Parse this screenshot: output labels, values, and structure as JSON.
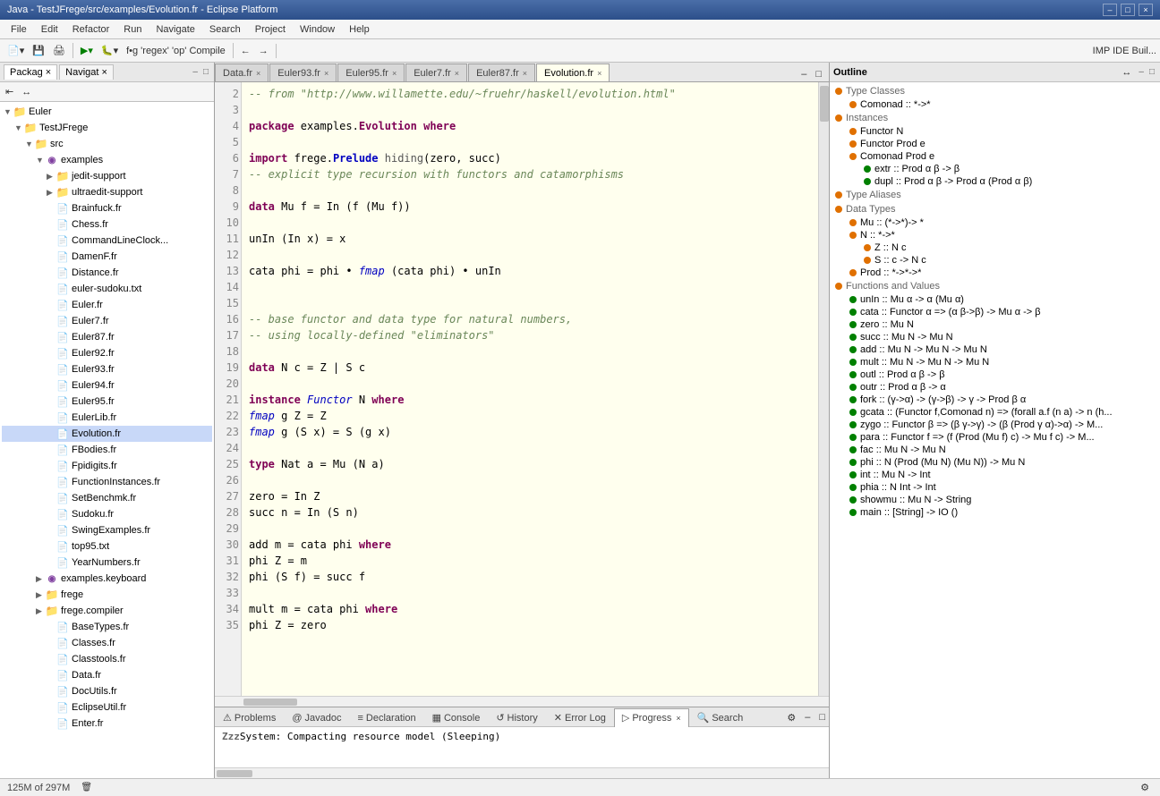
{
  "titlebar": {
    "title": "Java - TestJFrege/src/examples/Evolution.fr - Eclipse Platform",
    "controls": [
      "–",
      "□",
      "×"
    ]
  },
  "menubar": {
    "items": [
      "File",
      "Edit",
      "Refactor",
      "Run",
      "Navigate",
      "Search",
      "Project",
      "Window",
      "Help"
    ]
  },
  "left_panel": {
    "tabs": [
      {
        "label": "Packag",
        "active": true
      },
      {
        "label": "Navigat",
        "active": false
      }
    ],
    "tree": [
      {
        "indent": 0,
        "arrow": "▼",
        "icon": "folder",
        "label": "Euler",
        "level": 0
      },
      {
        "indent": 1,
        "arrow": "▼",
        "icon": "folder",
        "label": "TestJFrege",
        "level": 1
      },
      {
        "indent": 2,
        "arrow": "▼",
        "icon": "folder",
        "label": "src",
        "level": 2
      },
      {
        "indent": 3,
        "arrow": "▼",
        "icon": "package",
        "label": "examples",
        "level": 3
      },
      {
        "indent": 4,
        "arrow": "▶",
        "icon": "folder",
        "label": "jedit-support",
        "level": 4
      },
      {
        "indent": 4,
        "arrow": "▶",
        "icon": "folder",
        "label": "ultraedit-support",
        "level": 4
      },
      {
        "indent": 4,
        "arrow": "",
        "icon": "file",
        "label": "Brainfuck.fr",
        "level": 4
      },
      {
        "indent": 4,
        "arrow": "",
        "icon": "file",
        "label": "Chess.fr",
        "level": 4
      },
      {
        "indent": 4,
        "arrow": "",
        "icon": "file",
        "label": "CommandLineClock...",
        "level": 4
      },
      {
        "indent": 4,
        "arrow": "",
        "icon": "file",
        "label": "DamenF.fr",
        "level": 4
      },
      {
        "indent": 4,
        "arrow": "",
        "icon": "file",
        "label": "Distance.fr",
        "level": 4
      },
      {
        "indent": 4,
        "arrow": "",
        "icon": "file",
        "label": "euler-sudoku.txt",
        "level": 4
      },
      {
        "indent": 4,
        "arrow": "",
        "icon": "file",
        "label": "Euler.fr",
        "level": 4
      },
      {
        "indent": 4,
        "arrow": "",
        "icon": "file",
        "label": "Euler7.fr",
        "level": 4
      },
      {
        "indent": 4,
        "arrow": "",
        "icon": "file",
        "label": "Euler87.fr",
        "level": 4
      },
      {
        "indent": 4,
        "arrow": "",
        "icon": "file",
        "label": "Euler92.fr",
        "level": 4
      },
      {
        "indent": 4,
        "arrow": "",
        "icon": "file",
        "label": "Euler93.fr",
        "level": 4
      },
      {
        "indent": 4,
        "arrow": "",
        "icon": "file",
        "label": "Euler94.fr",
        "level": 4
      },
      {
        "indent": 4,
        "arrow": "",
        "icon": "file",
        "label": "Euler95.fr",
        "level": 4
      },
      {
        "indent": 4,
        "arrow": "",
        "icon": "file",
        "label": "EulerLib.fr",
        "level": 4
      },
      {
        "indent": 4,
        "arrow": "",
        "icon": "file",
        "label": "Evolution.fr",
        "level": 4,
        "selected": true
      },
      {
        "indent": 4,
        "arrow": "",
        "icon": "file",
        "label": "FBodies.fr",
        "level": 4
      },
      {
        "indent": 4,
        "arrow": "",
        "icon": "file",
        "label": "Fpidigits.fr",
        "level": 4
      },
      {
        "indent": 4,
        "arrow": "",
        "icon": "file",
        "label": "FunctionInstances.fr",
        "level": 4
      },
      {
        "indent": 4,
        "arrow": "",
        "icon": "file",
        "label": "SetBenchmk.fr",
        "level": 4
      },
      {
        "indent": 4,
        "arrow": "",
        "icon": "file",
        "label": "Sudoku.fr",
        "level": 4
      },
      {
        "indent": 4,
        "arrow": "",
        "icon": "file",
        "label": "SwingExamples.fr",
        "level": 4
      },
      {
        "indent": 4,
        "arrow": "",
        "icon": "file",
        "label": "top95.txt",
        "level": 4
      },
      {
        "indent": 4,
        "arrow": "",
        "icon": "file",
        "label": "YearNumbers.fr",
        "level": 4
      },
      {
        "indent": 3,
        "arrow": "▶",
        "icon": "package",
        "label": "examples.keyboard",
        "level": 3
      },
      {
        "indent": 3,
        "arrow": "▶",
        "icon": "folder",
        "label": "frege",
        "level": 3
      },
      {
        "indent": 3,
        "arrow": "▶",
        "icon": "folder",
        "label": "frege.compiler",
        "level": 3
      },
      {
        "indent": 4,
        "arrow": "",
        "icon": "file",
        "label": "BaseTypes.fr",
        "level": 4
      },
      {
        "indent": 4,
        "arrow": "",
        "icon": "file",
        "label": "Classes.fr",
        "level": 4
      },
      {
        "indent": 4,
        "arrow": "",
        "icon": "file",
        "label": "Classtools.fr",
        "level": 4
      },
      {
        "indent": 4,
        "arrow": "",
        "icon": "file",
        "label": "Data.fr",
        "level": 4
      },
      {
        "indent": 4,
        "arrow": "",
        "icon": "file",
        "label": "DocUtils.fr",
        "level": 4
      },
      {
        "indent": 4,
        "arrow": "",
        "icon": "file",
        "label": "EclipseUtil.fr",
        "level": 4
      },
      {
        "indent": 4,
        "arrow": "",
        "icon": "file",
        "label": "Enter.fr",
        "level": 4
      }
    ]
  },
  "editor": {
    "tabs": [
      {
        "label": "Data.fr",
        "active": false,
        "closeable": true
      },
      {
        "label": "Euler93.fr",
        "active": false,
        "closeable": true
      },
      {
        "label": "Euler95.fr",
        "active": false,
        "closeable": true
      },
      {
        "label": "Euler7.fr",
        "active": false,
        "closeable": true
      },
      {
        "label": "Euler87.fr",
        "active": false,
        "closeable": true
      },
      {
        "label": "Evolution.fr",
        "active": true,
        "closeable": true
      }
    ],
    "lines": [
      {
        "num": 2,
        "code": "<span class='comment'>-- from \"http://www.willamette.edu/~fruehr/haskell/evolution.html\"</span>"
      },
      {
        "num": 3,
        "code": ""
      },
      {
        "num": 4,
        "code": "<span class='kw'>package</span> examples.<span style='color:#7f0055;font-weight:bold'>Evolution</span> <span class='kw'>where</span>"
      },
      {
        "num": 5,
        "code": ""
      },
      {
        "num": 6,
        "code": "<span class='kw'>import</span> frege.<span style='color:#0000c0;font-weight:bold'>Prelude</span>  <span style='color:#555'>hiding</span>(zero, succ)"
      },
      {
        "num": 7,
        "code": "<span class='comment'>-- explicit type recursion with functors and catamorphisms</span>"
      },
      {
        "num": 8,
        "code": ""
      },
      {
        "num": 9,
        "code": "<span class='kw'>data</span> Mu f = In (f (Mu f))"
      },
      {
        "num": 10,
        "code": ""
      },
      {
        "num": 11,
        "code": "unIn (In x) = x"
      },
      {
        "num": 12,
        "code": ""
      },
      {
        "num": 13,
        "code": "cata phi = phi • <span class='fn-name'>fmap</span> (cata phi) • unIn"
      },
      {
        "num": 14,
        "code": ""
      },
      {
        "num": 15,
        "code": ""
      },
      {
        "num": 16,
        "code": "<span class='comment'>-- base functor and data type for natural numbers,</span>"
      },
      {
        "num": 17,
        "code": "<span class='comment'>-- using locally-defined \"eliminators\"</span>"
      },
      {
        "num": 18,
        "code": ""
      },
      {
        "num": 19,
        "code": "<span class='kw'>data</span> N c = Z | S c"
      },
      {
        "num": 20,
        "code": ""
      },
      {
        "num": 21,
        "code": "<span class='kw'>instance</span> <span class='fn-name'>Functor</span> N <span class='kw'>where</span>"
      },
      {
        "num": 22,
        "code": "    <span class='fn-name'>fmap</span> g  Z      = Z"
      },
      {
        "num": 23,
        "code": "    <span class='fn-name'>fmap</span> g (S x) = S (g x)"
      },
      {
        "num": 24,
        "code": ""
      },
      {
        "num": 25,
        "code": "<span class='kw'>type</span> Nat a = Mu (N a)"
      },
      {
        "num": 26,
        "code": ""
      },
      {
        "num": 27,
        "code": "zero    = In Z"
      },
      {
        "num": 28,
        "code": "succ n  = In (S n)"
      },
      {
        "num": 29,
        "code": ""
      },
      {
        "num": 30,
        "code": "add m = cata phi <span class='kw'>where</span>"
      },
      {
        "num": 31,
        "code": "    phi  Z      = m"
      },
      {
        "num": 32,
        "code": "    phi (S f) = succ f"
      },
      {
        "num": 33,
        "code": ""
      },
      {
        "num": 34,
        "code": "mult m = cata phi <span class='kw'>where</span>"
      },
      {
        "num": 35,
        "code": "    phi  Z      = zero"
      }
    ]
  },
  "outline": {
    "title": "Outline",
    "sections": [
      {
        "label": "Type Classes",
        "color": "orange",
        "items": [
          {
            "indent": 1,
            "label": "Comonad :: *->*",
            "color": "orange"
          }
        ]
      },
      {
        "label": "Instances",
        "color": "orange",
        "items": [
          {
            "indent": 1,
            "label": "Functor N",
            "color": "orange"
          },
          {
            "indent": 1,
            "label": "Functor Prod e",
            "color": "orange"
          },
          {
            "indent": 1,
            "label": "Comonad Prod e",
            "color": "orange"
          },
          {
            "indent": 2,
            "label": "extr :: Prod α β -> β",
            "color": "green"
          },
          {
            "indent": 2,
            "label": "dupl :: Prod α β -> Prod α (Prod α β)",
            "color": "green"
          }
        ]
      },
      {
        "label": "Type Aliases",
        "color": "orange",
        "items": []
      },
      {
        "label": "Data Types",
        "color": "orange",
        "items": [
          {
            "indent": 1,
            "label": "Mu :: (*->*)-> *",
            "color": "orange"
          },
          {
            "indent": 1,
            "label": "N :: *->*",
            "color": "orange"
          },
          {
            "indent": 2,
            "label": "Z :: N c",
            "color": "orange"
          },
          {
            "indent": 2,
            "label": "S :: c -> N c",
            "color": "orange"
          },
          {
            "indent": 1,
            "label": "Prod :: *->*->*",
            "color": "orange"
          }
        ]
      },
      {
        "label": "Functions and Values",
        "color": "orange",
        "items": [
          {
            "indent": 1,
            "label": "unIn :: Mu α -> α (Mu α)",
            "color": "green"
          },
          {
            "indent": 1,
            "label": "cata :: Functor α => (α β->β) -> Mu α -> β",
            "color": "green"
          },
          {
            "indent": 1,
            "label": "zero :: Mu N",
            "color": "green"
          },
          {
            "indent": 1,
            "label": "succ :: Mu N -> Mu N",
            "color": "green"
          },
          {
            "indent": 1,
            "label": "add :: Mu N -> Mu N -> Mu N",
            "color": "green"
          },
          {
            "indent": 1,
            "label": "mult :: Mu N -> Mu N -> Mu N",
            "color": "green"
          },
          {
            "indent": 1,
            "label": "outl :: Prod α β -> β",
            "color": "green"
          },
          {
            "indent": 1,
            "label": "outr :: Prod α β -> α",
            "color": "green"
          },
          {
            "indent": 1,
            "label": "fork :: (γ->α) -> (γ->β) -> γ -> Prod β α",
            "color": "green"
          },
          {
            "indent": 1,
            "label": "gcata :: (Functor f,Comonad n) => (forall a.f (n a) -> n (h...",
            "color": "green"
          },
          {
            "indent": 1,
            "label": "zygo :: Functor β => (β γ->γ) -> (β (Prod γ α)->α) -> M...",
            "color": "green"
          },
          {
            "indent": 1,
            "label": "para :: Functor f => (f (Prod (Mu f) c) -> Mu f c) -> M...",
            "color": "green"
          },
          {
            "indent": 1,
            "label": "fac :: Mu N -> Mu N",
            "color": "green"
          },
          {
            "indent": 1,
            "label": "phi :: N (Prod (Mu N) (Mu N)) -> Mu N",
            "color": "green"
          },
          {
            "indent": 1,
            "label": "int :: Mu N -> Int",
            "color": "green"
          },
          {
            "indent": 1,
            "label": "phia :: N Int -> Int",
            "color": "green"
          },
          {
            "indent": 1,
            "label": "showmu :: Mu N -> String",
            "color": "green"
          },
          {
            "indent": 1,
            "label": "main :: [String] -> IO ()",
            "color": "green"
          }
        ]
      }
    ]
  },
  "bottom_panel": {
    "tabs": [
      {
        "label": "Problems",
        "icon": "⚠",
        "active": false
      },
      {
        "label": "Javadoc",
        "icon": "@",
        "active": false
      },
      {
        "label": "Declaration",
        "icon": "≡",
        "active": false
      },
      {
        "label": "Console",
        "icon": "▦",
        "active": false
      },
      {
        "label": "History",
        "icon": "↺",
        "active": false
      },
      {
        "label": "Error Log",
        "icon": "✕",
        "active": false
      },
      {
        "label": "Progress",
        "icon": "▷",
        "active": true
      },
      {
        "label": "Search",
        "icon": "🔍",
        "active": false
      }
    ],
    "status_text": "System: Compacting resource model (Sleeping)",
    "sleep_label": "Zzz"
  },
  "statusbar": {
    "memory": "125M of 297M"
  }
}
